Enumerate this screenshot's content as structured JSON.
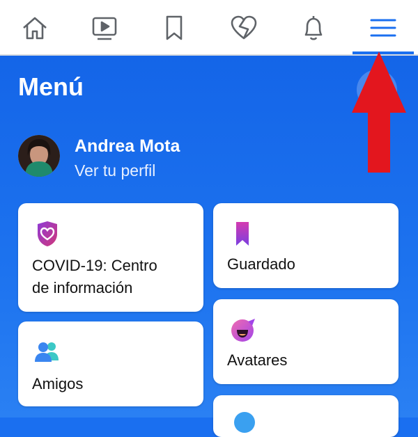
{
  "nav": {
    "items": [
      {
        "name": "home",
        "icon": "home-icon"
      },
      {
        "name": "watch",
        "icon": "video-icon"
      },
      {
        "name": "saved",
        "icon": "bookmark-icon"
      },
      {
        "name": "dating",
        "icon": "heart-icon"
      },
      {
        "name": "notifications",
        "icon": "bell-icon"
      },
      {
        "name": "menu",
        "icon": "hamburger-menu-icon",
        "active": true
      }
    ],
    "accent_color": "#1a6ff0"
  },
  "header": {
    "title": "Menú"
  },
  "profile": {
    "name": "Andrea Mota",
    "subtitle": "Ver tu perfil"
  },
  "cards": {
    "covid": {
      "label": "COVID-19: Centro\nde información",
      "icon": "covid-shield-heart-icon"
    },
    "saved": {
      "label": "Guardado",
      "icon": "bookmark-icon"
    },
    "friends": {
      "label": "Amigos",
      "icon": "friends-icon"
    },
    "avatars": {
      "label": "Avatares",
      "icon": "avatar-face-icon"
    }
  },
  "annotation": {
    "type": "red-arrow-pointing-up",
    "color": "#e3161e"
  }
}
